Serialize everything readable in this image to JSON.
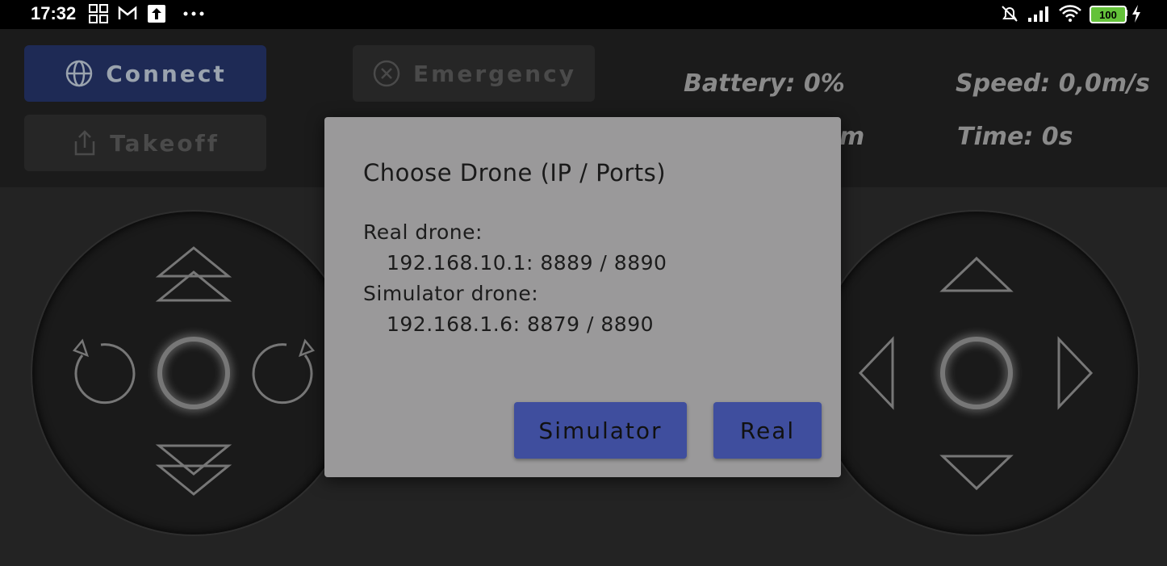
{
  "status_bar": {
    "time": "17:32",
    "battery_level": "100",
    "left_icons": [
      "grid-icon",
      "gmail-icon",
      "upload-icon",
      "more-dots-icon"
    ],
    "right_icons": [
      "alarm-off-icon",
      "signal-icon",
      "wifi-icon",
      "battery-icon",
      "charging-icon"
    ]
  },
  "controls": {
    "connect_label": "Connect",
    "takeoff_label": "Takeoff",
    "emergency_label": "Emergency"
  },
  "stats": {
    "battery": "Battery: 0%",
    "speed": "Speed: 0,0m/s",
    "height_partial": "m",
    "time": "Time: 0s"
  },
  "dialog": {
    "title": "Choose Drone (IP / Ports)",
    "real_heading": "Real drone:",
    "real_address": "192.168.10.1: 8889 / 8890",
    "sim_heading": "Simulator drone:",
    "sim_address": "192.168.1.6: 8879 / 8890",
    "simulator_button": "Simulator",
    "real_button": "Real"
  },
  "colors": {
    "accent_button": "#3f4e9e",
    "connect_button": "#1e2a55",
    "dialog_background": "#9a999a"
  }
}
